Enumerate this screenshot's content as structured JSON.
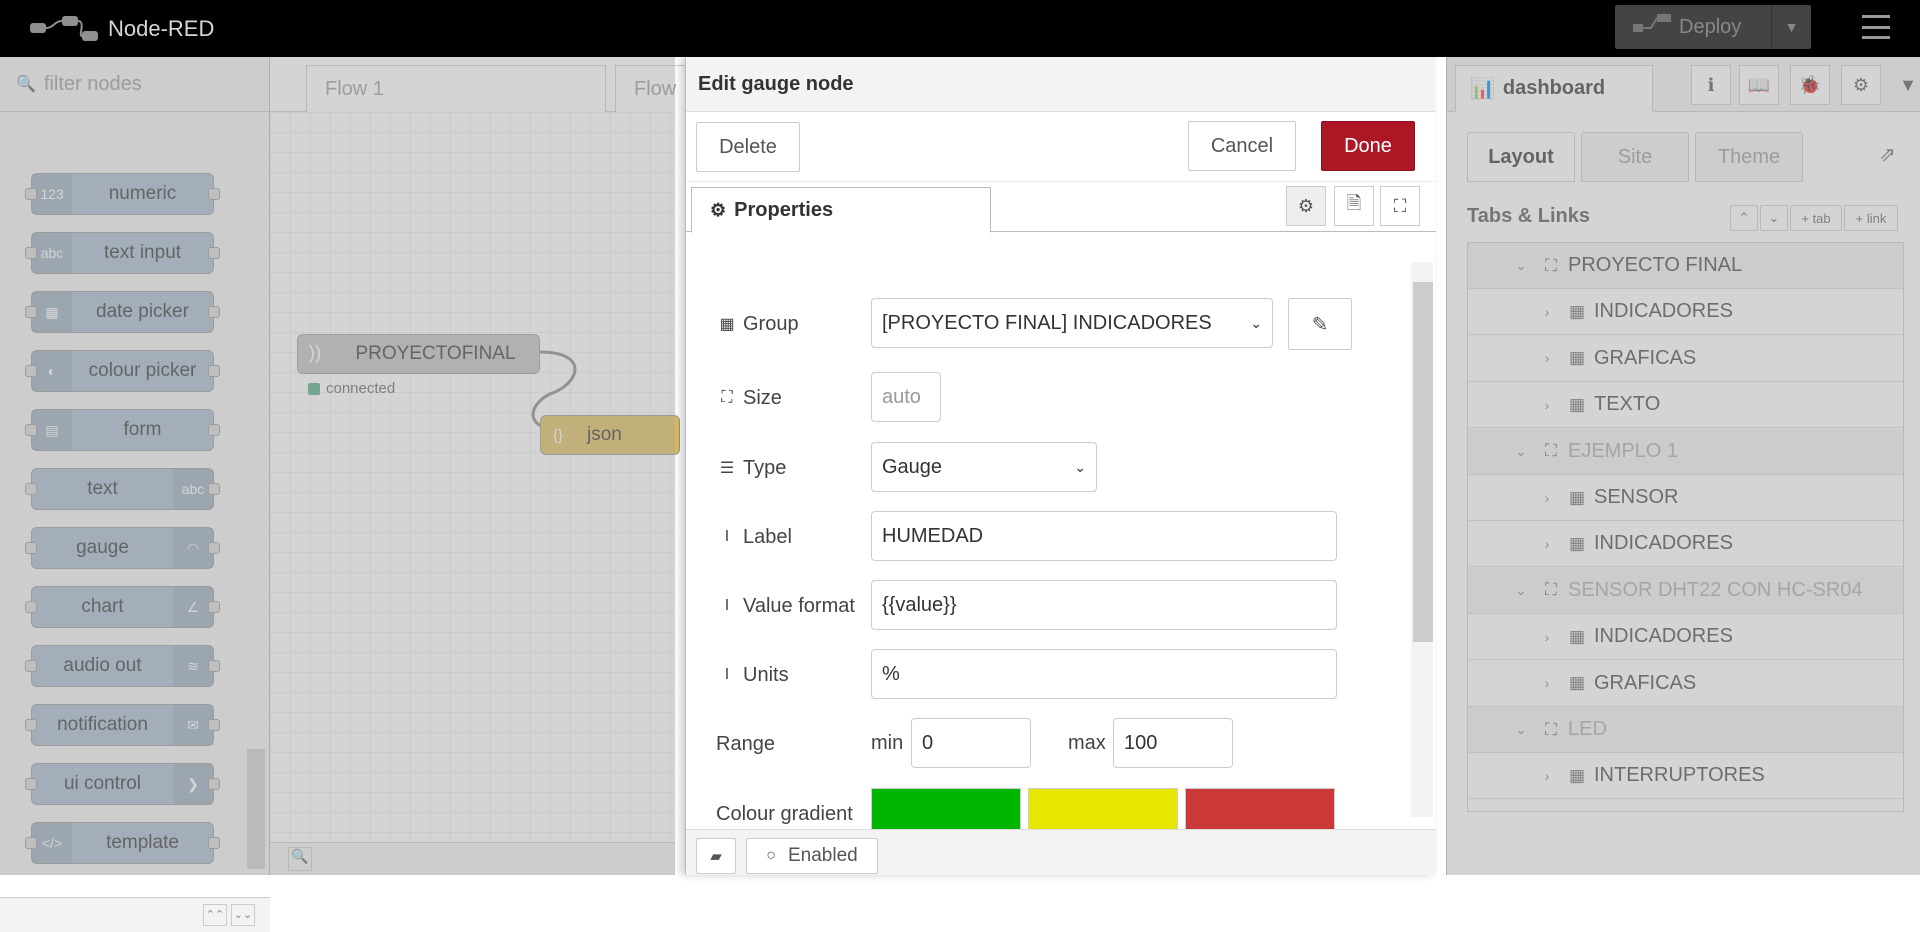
{
  "header": {
    "title": "Node-RED",
    "deploy_label": "Deploy"
  },
  "palette": {
    "filter_placeholder": "filter nodes",
    "nodes": [
      "numeric",
      "text input",
      "date picker",
      "colour picker",
      "form",
      "text",
      "gauge",
      "chart",
      "audio out",
      "notification",
      "ui control",
      "template"
    ],
    "node_icons": [
      "123",
      "abc",
      "▦",
      "◐",
      "▤",
      "abc",
      "◠",
      "∠",
      "≋",
      "✉",
      "❯",
      "</>"
    ]
  },
  "workspace": {
    "tabs": [
      "Flow 1",
      "Flow"
    ],
    "node1": {
      "label": "PROYECTOFINAL",
      "status": "connected"
    },
    "node2": {
      "label": "json",
      "icon": "{}"
    }
  },
  "editor": {
    "title": "Edit gauge node",
    "delete_label": "Delete",
    "cancel_label": "Cancel",
    "done_label": "Done",
    "tab_properties": "Properties",
    "fields": {
      "group_label": "Group",
      "group_value": "[PROYECTO FINAL] INDICADORES",
      "size_label": "Size",
      "size_value": "auto",
      "type_label": "Type",
      "type_value": "Gauge",
      "label_label": "Label",
      "label_value": "HUMEDAD",
      "format_label": "Value format",
      "format_value": "{{value}}",
      "units_label": "Units",
      "units_value": "%",
      "range_label": "Range",
      "min_label": "min",
      "min_value": "0",
      "max_label": "max",
      "max_value": "100",
      "gradient_label": "Colour gradient"
    },
    "gradient_colors": [
      "#00b500",
      "#e6e600",
      "#ca3838"
    ],
    "enabled_label": "Enabled"
  },
  "sidebar": {
    "tab_label": "dashboard",
    "dash_tabs": [
      "Layout",
      "Site",
      "Theme"
    ],
    "tabs_links_title": "Tabs & Links",
    "mini_tab": "tab",
    "mini_link": "link",
    "tree": [
      {
        "type": "tab",
        "label": "PROYECTO FINAL"
      },
      {
        "type": "group",
        "label": "INDICADORES"
      },
      {
        "type": "group",
        "label": "GRAFICAS"
      },
      {
        "type": "group",
        "label": "TEXTO"
      },
      {
        "type": "tab",
        "label": "EJEMPLO 1"
      },
      {
        "type": "group",
        "label": "SENSOR"
      },
      {
        "type": "group",
        "label": "INDICADORES"
      },
      {
        "type": "tab",
        "label": "SENSOR DHT22 CON HC-SR04"
      },
      {
        "type": "group",
        "label": "INDICADORES"
      },
      {
        "type": "group",
        "label": "GRAFICAS"
      },
      {
        "type": "tab",
        "label": "LED"
      },
      {
        "type": "group",
        "label": "INTERRUPTORES"
      }
    ]
  }
}
